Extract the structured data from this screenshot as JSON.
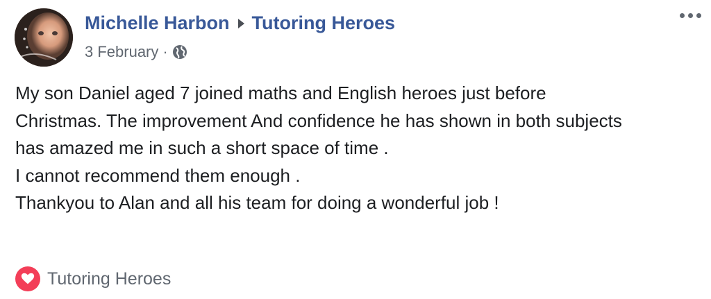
{
  "post": {
    "author": "Michelle Harbon",
    "target_page": "Tutoring Heroes",
    "date": "3 February",
    "separator": "·",
    "privacy_icon": "globe-icon",
    "more_icon": "more-options-icon",
    "body_lines": [
      "My son Daniel aged 7 joined maths and English heroes just before",
      "Christmas. The improvement And confidence he has shown in both subjects",
      "has amazed me in such a short space of time .",
      "I cannot recommend them enough .",
      "Thankyou to Alan and all his team for doing a wonderful job !"
    ],
    "reaction": {
      "icon": "love-icon",
      "label": "Tutoring Heroes"
    }
  },
  "colors": {
    "link": "#385898",
    "meta": "#606770",
    "text": "#1c1e21",
    "love": "#f33e58"
  }
}
